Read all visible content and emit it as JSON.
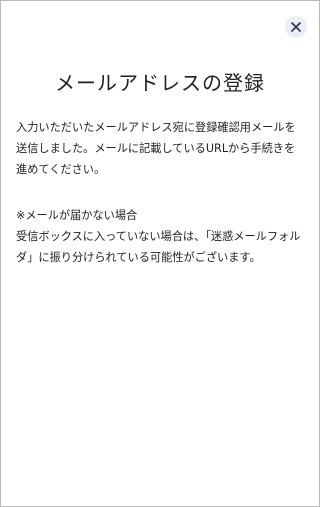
{
  "dialog": {
    "close_icon": "close-icon",
    "title": "メールアドレスの登録",
    "message": "入力いただいたメールアドレス宛に登録確認用メールを送信しました。メールに記載しているURLから手続きを進めてください。",
    "note_heading": "※メールが届かない場合",
    "note_text": "受信ボックスに入っていない場合は、「迷惑メールフォルダ」に振り分けられている可能性がございます。"
  },
  "colors": {
    "close_button_bg": "#eceef6",
    "close_icon": "#2b2f4a",
    "border": "#b8b8b8",
    "text": "#222222"
  }
}
